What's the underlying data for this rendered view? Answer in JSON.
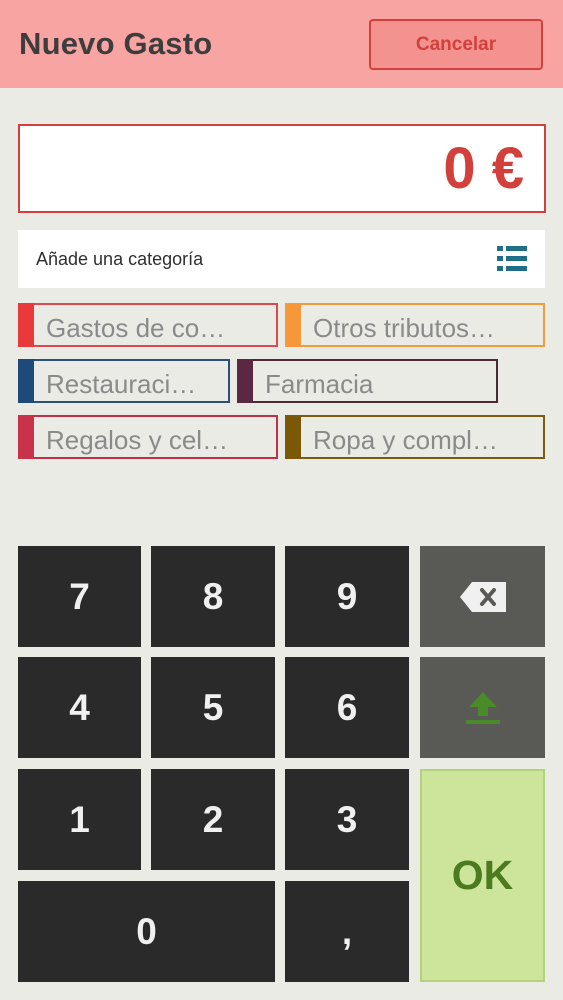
{
  "header": {
    "title": "Nuevo Gasto",
    "cancel_label": "Cancelar"
  },
  "amount": {
    "value": "0 €"
  },
  "category": {
    "placeholder": "Añade una categoría",
    "icon": "list-icon"
  },
  "chips": [
    {
      "label": "Gastos de co…",
      "color": "#e8393b",
      "border": "#d9494d"
    },
    {
      "label": "Otros tributos…",
      "color": "#f6973a",
      "border": "#f29a3c"
    },
    {
      "label": "Restauraci…",
      "color": "#1e4a7a",
      "border": "#2a5079"
    },
    {
      "label": "Farmacia",
      "color": "#5a2840",
      "border": "#4a2a38"
    },
    {
      "label": "Regalos y cel…",
      "color": "#c8334a",
      "border": "#c03048"
    },
    {
      "label": "Ropa y compl…",
      "color": "#7a5808",
      "border": "#7a5b12"
    }
  ],
  "keypad": {
    "k7": "7",
    "k8": "8",
    "k9": "9",
    "k4": "4",
    "k5": "5",
    "k6": "6",
    "k1": "1",
    "k2": "2",
    "k3": "3",
    "k0": "0",
    "comma": ",",
    "ok": "OK",
    "backspace_icon": "backspace-icon",
    "upload_icon": "upload-icon"
  }
}
